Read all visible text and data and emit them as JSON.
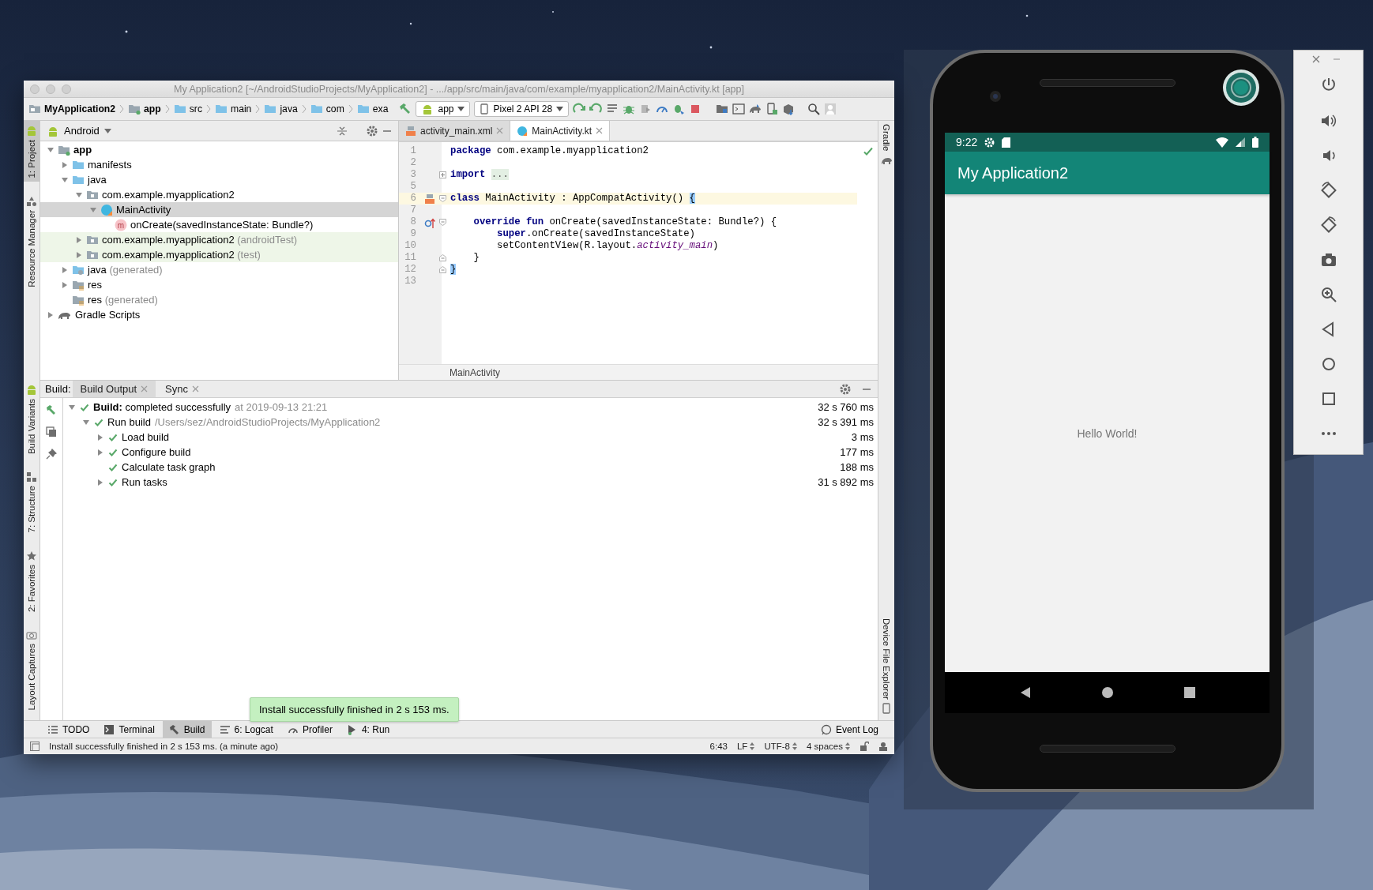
{
  "ide": {
    "title": "My Application2 [~/AndroidStudioProjects/MyApplication2] - .../app/src/main/java/com/example/myapplication2/MainActivity.kt [app]",
    "navigation": {
      "breadcrumbs": [
        {
          "label": "MyApplication2",
          "kind": "project"
        },
        {
          "label": "app",
          "kind": "module"
        },
        {
          "label": "src",
          "kind": "folder"
        },
        {
          "label": "main",
          "kind": "folder"
        },
        {
          "label": "java",
          "kind": "source-folder"
        },
        {
          "label": "com",
          "kind": "folder"
        },
        {
          "label": "exa",
          "kind": "folder"
        }
      ],
      "run_config": "app",
      "device": "Pixel 2 API 28"
    },
    "left_tool_windows": {
      "top": [
        {
          "label": "1: Project",
          "kind": "android",
          "selected": true
        },
        {
          "label": "Resource Manager",
          "kind": "shapes",
          "selected": false
        }
      ],
      "bottom": [
        {
          "label": "Build Variants",
          "kind": "android",
          "selected": false
        },
        {
          "label": "7: Structure",
          "kind": "structure",
          "selected": false
        },
        {
          "label": "2: Favorites",
          "kind": "star",
          "selected": false
        },
        {
          "label": "Layout Captures",
          "kind": "camera",
          "selected": false
        }
      ]
    },
    "right_tool_windows": {
      "top": [
        {
          "label": "Gradle",
          "kind": "elephant",
          "selected": false
        }
      ],
      "bottom": [
        {
          "label": "Device File Explorer",
          "kind": "phone",
          "selected": false
        }
      ]
    },
    "project": {
      "view": "Android",
      "tree": [
        {
          "label": "app",
          "kind": "module",
          "expanded": true,
          "selected": false,
          "test_source": false,
          "children": [
            {
              "label": "manifests",
              "kind": "folder",
              "expanded": false,
              "selected": false,
              "test_source": false
            },
            {
              "label": "java",
              "kind": "folder",
              "expanded": true,
              "selected": false,
              "test_source": false,
              "children": [
                {
                  "label": "com.example.myapplication2",
                  "kind": "package",
                  "expanded": true,
                  "selected": false,
                  "test_source": false,
                  "children": [
                    {
                      "label": "MainActivity",
                      "kind": "class",
                      "expanded": true,
                      "selected": true,
                      "test_source": false,
                      "children": [
                        {
                          "label": "onCreate(savedInstanceState: Bundle?)",
                          "kind": "method",
                          "icon_text": "m",
                          "selected": false,
                          "test_source": false
                        }
                      ]
                    }
                  ]
                },
                {
                  "label": "com.example.myapplication2",
                  "suffix": "(androidTest)",
                  "kind": "package",
                  "expanded": false,
                  "selected": false,
                  "test_source": true
                },
                {
                  "label": "com.example.myapplication2",
                  "suffix": "(test)",
                  "kind": "package",
                  "expanded": false,
                  "selected": false,
                  "test_source": true
                }
              ]
            },
            {
              "label": "java",
              "suffix": "(generated)",
              "kind": "generated-folder",
              "expanded": false,
              "selected": false,
              "test_source": false
            },
            {
              "label": "res",
              "kind": "res-folder",
              "expanded": false,
              "selected": false,
              "test_source": false
            },
            {
              "label": "res",
              "suffix": "(generated)",
              "kind": "res-folder",
              "selected": false,
              "test_source": false
            }
          ]
        },
        {
          "label": "Gradle Scripts",
          "kind": "gradle",
          "expanded": false,
          "selected": false,
          "test_source": false
        }
      ]
    },
    "editor": {
      "tabs": [
        {
          "label": "activity_main.xml",
          "kind": "xml",
          "selected": false
        },
        {
          "label": "MainActivity.kt",
          "kind": "kotlin",
          "selected": true
        }
      ],
      "lines": [
        {
          "number": "1",
          "current": false,
          "tokens": [
            {
              "kind": "keyword",
              "text": "package"
            },
            {
              "kind": "plain",
              "text": " com.example.myapplication2"
            }
          ]
        },
        {
          "number": "2",
          "current": false
        },
        {
          "number": "3",
          "current": false,
          "fold": {
            "kind": "collapsed"
          },
          "tokens": [
            {
              "kind": "keyword",
              "text": "import "
            },
            {
              "kind": "folded",
              "text": "..."
            }
          ]
        },
        {
          "number": "5",
          "current": false
        },
        {
          "number": "6",
          "current": true,
          "gutter": {
            "kind": "layout"
          },
          "fold": {
            "kind": "start"
          },
          "tokens": [
            {
              "kind": "keyword",
              "text": "class"
            },
            {
              "kind": "plain",
              "text": " MainActivity : AppCompatActivity() "
            },
            {
              "kind": "brace-match",
              "text": "{"
            }
          ]
        },
        {
          "number": "7",
          "current": false
        },
        {
          "number": "8",
          "current": false,
          "gutter": {
            "kind": "override"
          },
          "fold": {
            "kind": "start"
          },
          "tokens": [
            {
              "kind": "keyword",
              "text": "    override fun"
            },
            {
              "kind": "plain",
              "text": " onCreate(savedInstanceState: Bundle?) {"
            }
          ]
        },
        {
          "number": "9",
          "current": false,
          "tokens": [
            {
              "kind": "keyword",
              "text": "        super"
            },
            {
              "kind": "plain",
              "text": ".onCreate(savedInstanceState)"
            }
          ]
        },
        {
          "number": "10",
          "current": false,
          "tokens": [
            {
              "kind": "plain",
              "text": "        setContentView(R.layout."
            },
            {
              "kind": "field",
              "text": "activity_main"
            },
            {
              "kind": "plain",
              "text": ")"
            }
          ]
        },
        {
          "number": "11",
          "current": false,
          "fold": {
            "kind": "end"
          },
          "tokens": [
            {
              "kind": "plain",
              "text": "    }"
            }
          ]
        },
        {
          "number": "12",
          "current": false,
          "fold": {
            "kind": "end"
          },
          "tokens": [
            {
              "kind": "brace-match",
              "text": "}"
            }
          ]
        },
        {
          "number": "13",
          "current": false
        }
      ],
      "breadcrumb": "MainActivity"
    },
    "build": {
      "label": "Build:",
      "tabs": [
        {
          "label": "Build Output",
          "selected": true
        },
        {
          "label": "Sync",
          "selected": false
        }
      ],
      "rows": [
        {
          "label": "**Build:** completed successfully",
          "detail": "at 2019-09-13 21:21",
          "time": "32 s 760 ms",
          "kind": "success",
          "expanded": true,
          "children": [
            {
              "label": "Run build",
              "detail": "/Users/sez/AndroidStudioProjects/MyApplication2",
              "time": "32 s 391 ms",
              "kind": "success",
              "expanded": true,
              "children": [
                {
                  "label": "Load build",
                  "time": "3 ms",
                  "kind": "success",
                  "expanded": false
                },
                {
                  "label": "Configure build",
                  "time": "177 ms",
                  "kind": "success",
                  "expanded": false
                },
                {
                  "label": "Calculate task graph",
                  "time": "188 ms",
                  "kind": "success"
                },
                {
                  "label": "Run tasks",
                  "time": "31 s 892 ms",
                  "kind": "success",
                  "expanded": false
                }
              ]
            }
          ]
        }
      ]
    },
    "notification": "Install successfully finished in 2 s 153 ms.",
    "tool_bar": {
      "left": [
        {
          "label": "TODO",
          "kind": "list",
          "selected": false
        },
        {
          "label": "Terminal",
          "kind": "terminal",
          "selected": false
        },
        {
          "label": "Build",
          "kind": "hammer",
          "selected": true
        },
        {
          "label": "6: Logcat",
          "kind": "logcat",
          "selected": false
        },
        {
          "label": "Profiler",
          "kind": "gauge",
          "selected": false
        },
        {
          "label": "4: Run",
          "kind": "run",
          "selected": false
        }
      ],
      "right": [
        {
          "label": "Event Log",
          "kind": "bubble",
          "selected": false
        }
      ]
    },
    "status_bar": {
      "message": "Install successfully finished in 2 s 153 ms. (a minute ago)",
      "items": [
        {
          "text": "6:43",
          "menu": false
        },
        {
          "text": "LF",
          "menu": true
        },
        {
          "text": "UTF-8",
          "menu": true
        },
        {
          "text": "4 spaces",
          "menu": true
        }
      ]
    }
  },
  "emulator": {
    "status_bar": {
      "time": "9:22"
    },
    "app_title": "My Application2",
    "content_text": "Hello World!"
  }
}
